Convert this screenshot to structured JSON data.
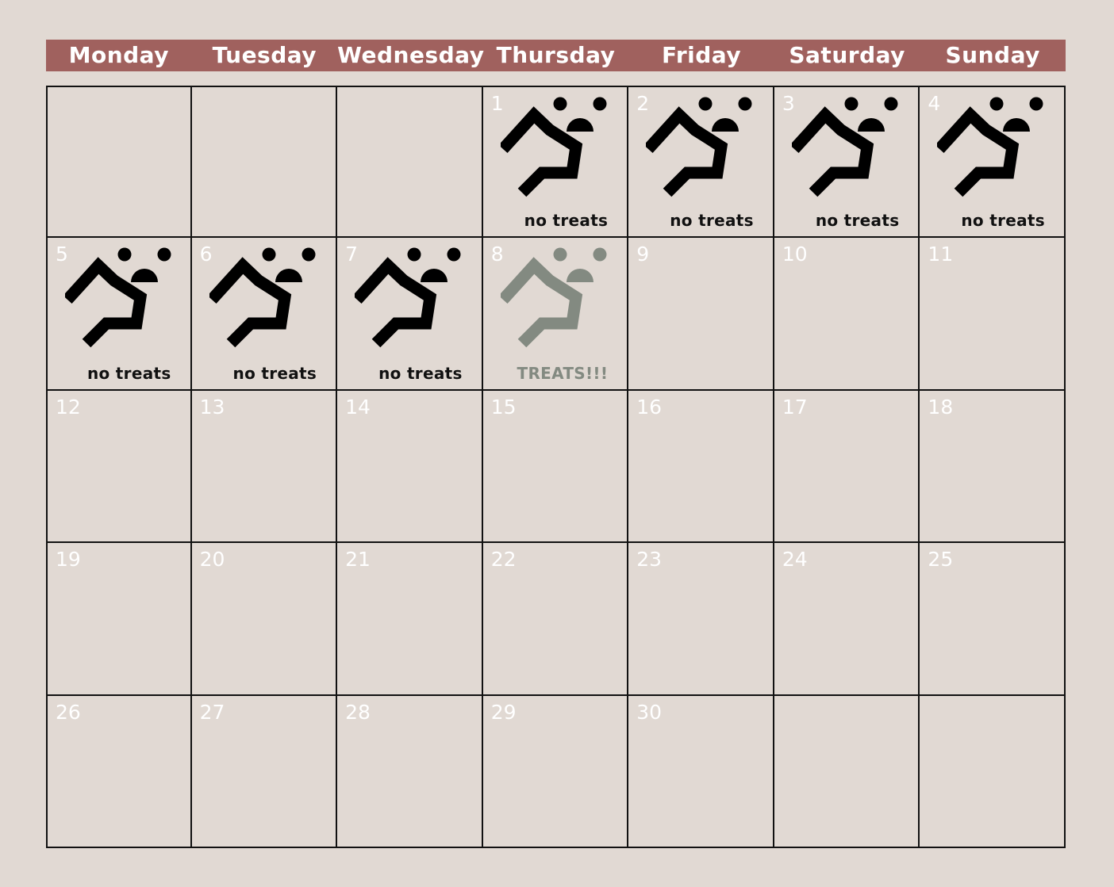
{
  "weekdays": [
    "Monday",
    "Tuesday",
    "Wednesday",
    "Thursday",
    "Friday",
    "Saturday",
    "Sunday"
  ],
  "colors": {
    "background": "#e1d9d3",
    "header": "#a0615e",
    "icon_default": "#000000",
    "icon_special": "#838a81"
  },
  "icon_name": "running-figure-icon",
  "cells": [
    {
      "day": "",
      "note": ""
    },
    {
      "day": "",
      "note": ""
    },
    {
      "day": "",
      "note": ""
    },
    {
      "day": "1",
      "note": "no treats",
      "style": "default"
    },
    {
      "day": "2",
      "note": "no treats",
      "style": "default"
    },
    {
      "day": "3",
      "note": "no treats",
      "style": "default"
    },
    {
      "day": "4",
      "note": "no treats",
      "style": "default"
    },
    {
      "day": "5",
      "note": "no treats",
      "style": "default"
    },
    {
      "day": "6",
      "note": "no treats",
      "style": "default"
    },
    {
      "day": "7",
      "note": "no treats",
      "style": "default"
    },
    {
      "day": "8",
      "note": "TREATS!!!",
      "style": "special"
    },
    {
      "day": "9",
      "note": ""
    },
    {
      "day": "10",
      "note": ""
    },
    {
      "day": "11",
      "note": ""
    },
    {
      "day": "12",
      "note": ""
    },
    {
      "day": "13",
      "note": ""
    },
    {
      "day": "14",
      "note": ""
    },
    {
      "day": "15",
      "note": ""
    },
    {
      "day": "16",
      "note": ""
    },
    {
      "day": "17",
      "note": ""
    },
    {
      "day": "18",
      "note": ""
    },
    {
      "day": "19",
      "note": ""
    },
    {
      "day": "20",
      "note": ""
    },
    {
      "day": "21",
      "note": ""
    },
    {
      "day": "22",
      "note": ""
    },
    {
      "day": "23",
      "note": ""
    },
    {
      "day": "24",
      "note": ""
    },
    {
      "day": "25",
      "note": ""
    },
    {
      "day": "26",
      "note": ""
    },
    {
      "day": "27",
      "note": ""
    },
    {
      "day": "28",
      "note": ""
    },
    {
      "day": "29",
      "note": ""
    },
    {
      "day": "30",
      "note": ""
    },
    {
      "day": "",
      "note": ""
    },
    {
      "day": "",
      "note": ""
    }
  ]
}
